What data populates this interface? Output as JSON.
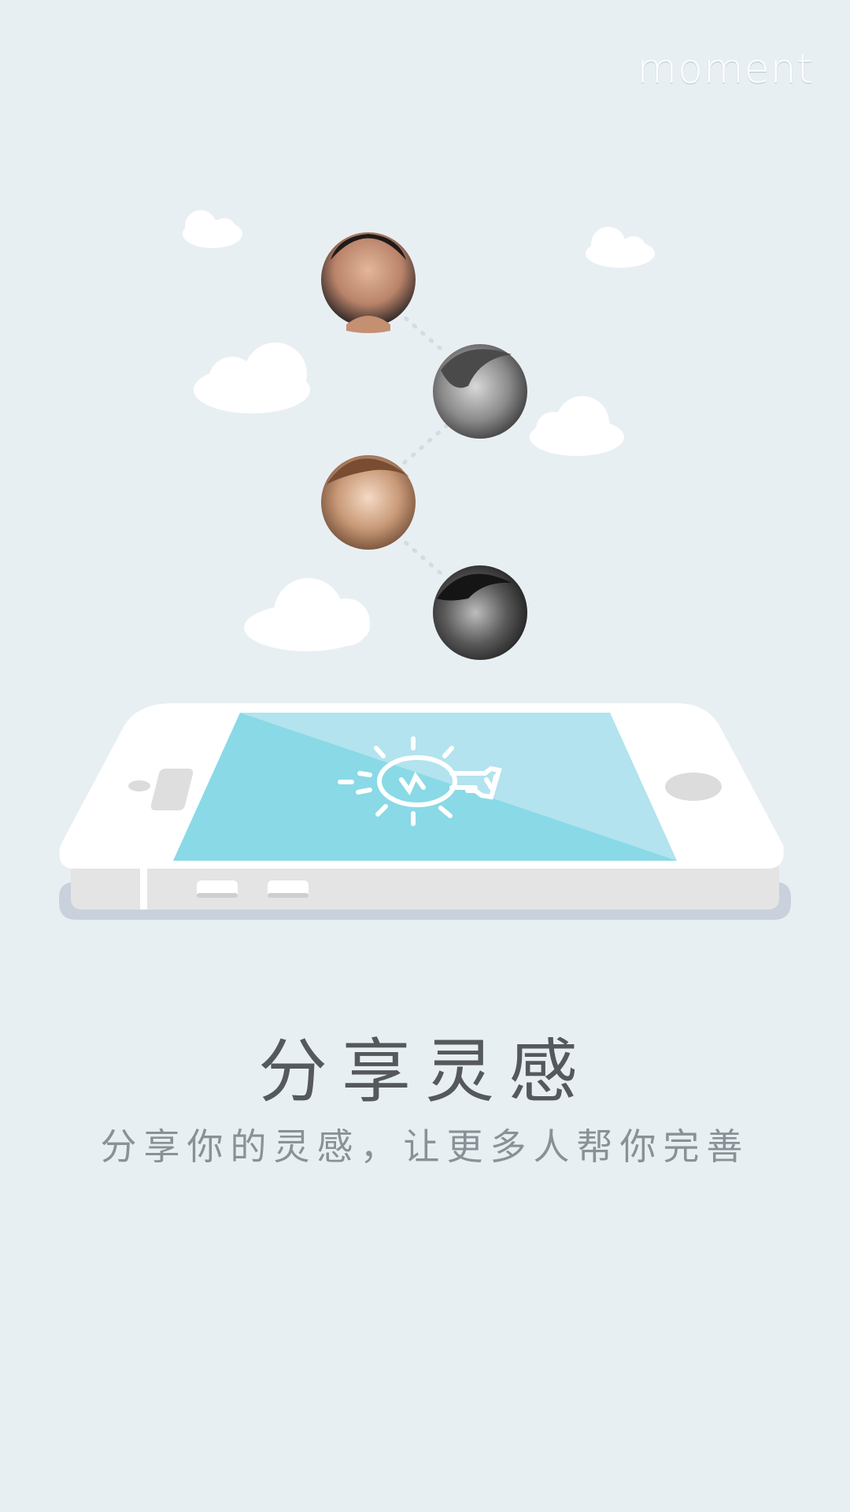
{
  "brand": {
    "logo_text": "moment"
  },
  "onboarding": {
    "headline": "分享灵感",
    "subline": "分享你的灵感，让更多人帮你完善"
  },
  "illustration": {
    "avatars": [
      "avatar-man-1",
      "avatar-woman-1",
      "avatar-woman-2",
      "avatar-man-2"
    ],
    "screen_icon": "lightbulb-icon",
    "colors": {
      "background": "#e8eff3",
      "screen": "#8ad9e6",
      "phone_body": "#ffffff",
      "cloud": "#ffffff"
    }
  }
}
